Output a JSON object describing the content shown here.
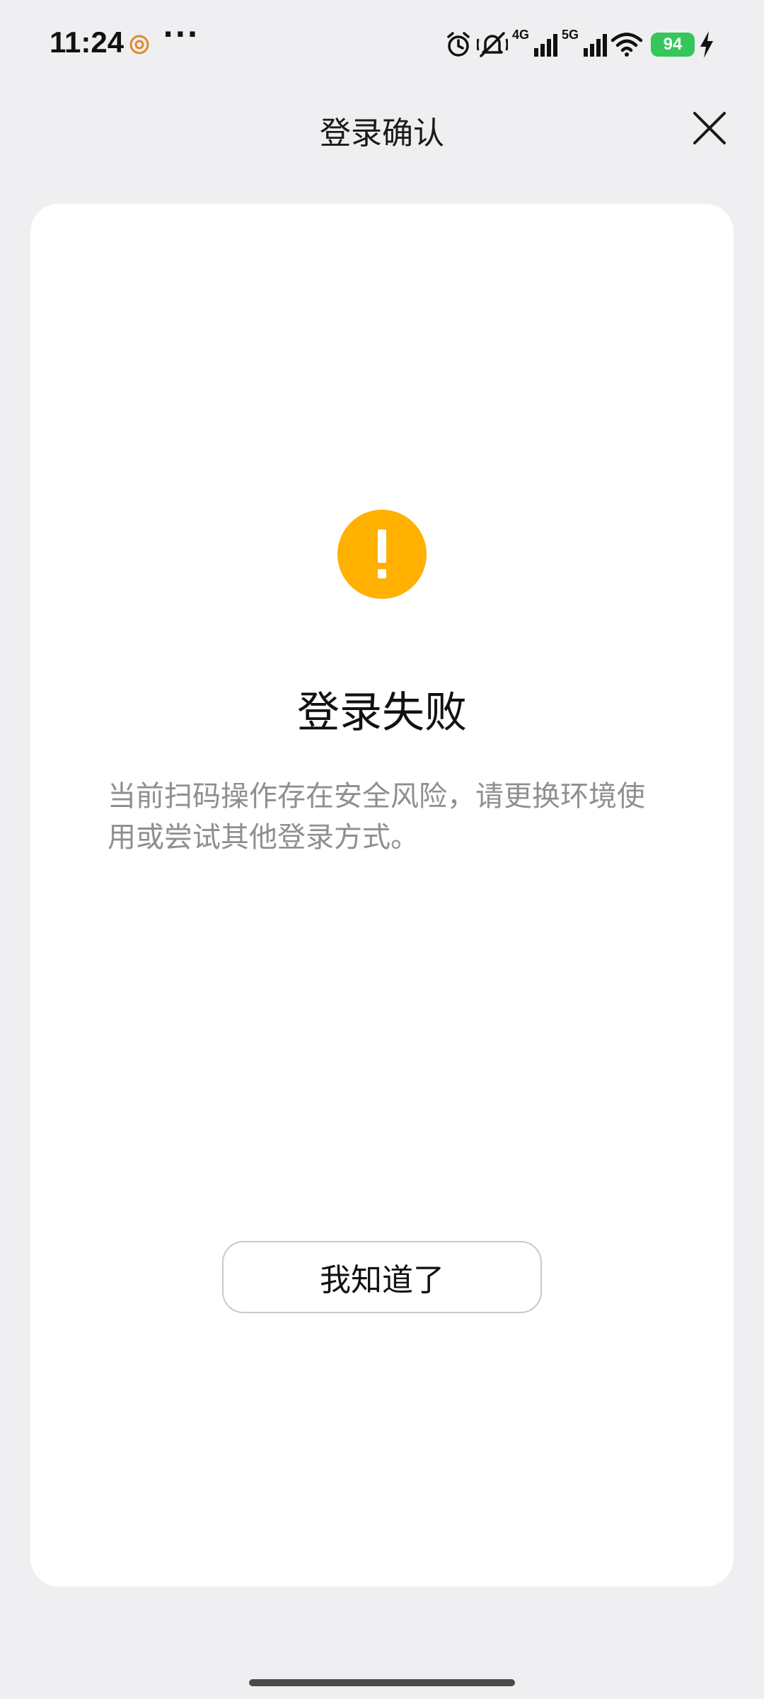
{
  "status_bar": {
    "time": "11:24",
    "more": "···",
    "net_4g": "4G",
    "net_5g": "5G",
    "battery": "94",
    "icons": [
      "app-notification-icon",
      "alarm-icon",
      "mute-icon",
      "signal-4g-icon",
      "signal-5g-icon",
      "wifi-icon",
      "battery-icon",
      "charging-icon"
    ]
  },
  "header": {
    "title": "登录确认",
    "close_icon": "close-icon"
  },
  "result": {
    "icon": "warning-icon",
    "icon_color": "#ffb000",
    "title": "登录失败",
    "description": "当前扫码操作存在安全风险，请更换环境使用或尝试其他登录方式。",
    "button_label": "我知道了"
  },
  "colors": {
    "background": "#efeff1",
    "card": "#ffffff",
    "description_text": "#8f8f8f",
    "battery": "#34c759"
  }
}
